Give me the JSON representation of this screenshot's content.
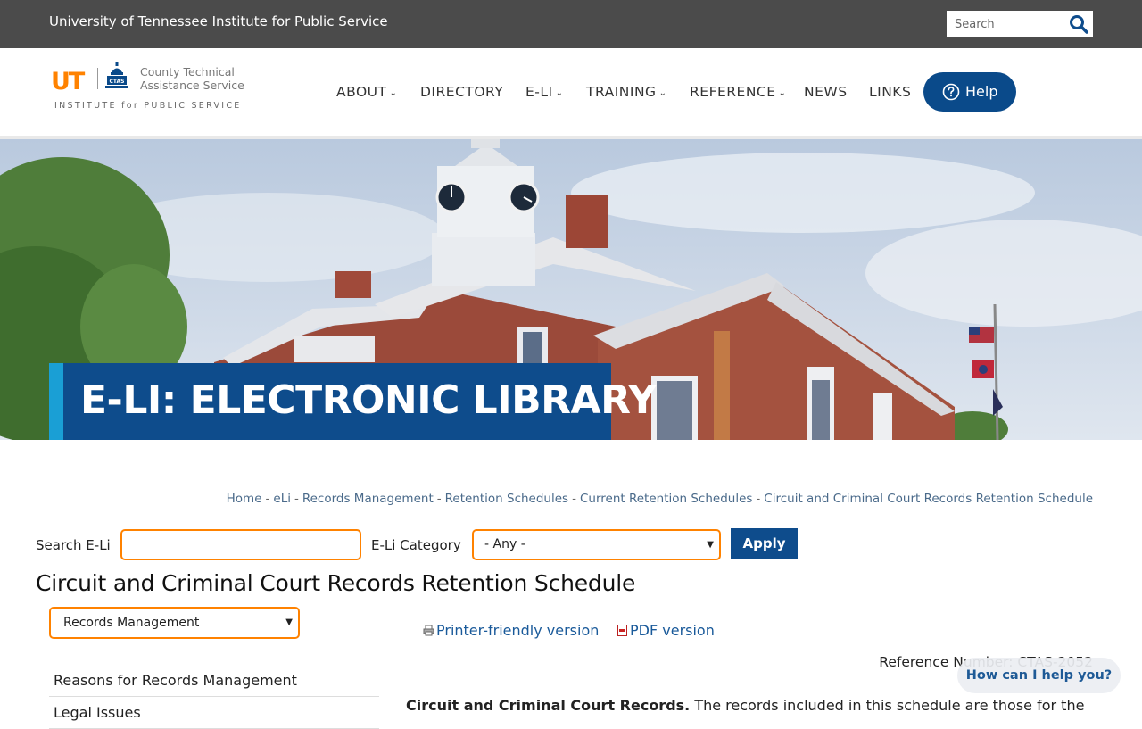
{
  "topbar": {
    "university": "University of Tennessee Institute for Public Service",
    "search_placeholder": "Search",
    "search_icon": "search-icon"
  },
  "logo": {
    "ut": "UT",
    "ctas_badge": "CTAS",
    "ctas_line1": "County Technical",
    "ctas_line2": "Assistance Service",
    "institute": "INSTITUTE for PUBLIC SERVICE"
  },
  "nav": {
    "items": [
      {
        "label": "ABOUT",
        "dropdown": true
      },
      {
        "label": "DIRECTORY",
        "dropdown": false
      },
      {
        "label": "E-LI",
        "dropdown": true
      },
      {
        "label": "TRAINING",
        "dropdown": true
      },
      {
        "label": "REFERENCE",
        "dropdown": true
      },
      {
        "label": "NEWS",
        "dropdown": false
      },
      {
        "label": "LINKS",
        "dropdown": false
      }
    ],
    "help_label": "Help",
    "help_icon": "question-circle-icon",
    "chevron": "⌄"
  },
  "hero": {
    "title": "E-LI: ELECTRONIC LIBRARY"
  },
  "breadcrumb": {
    "items": [
      "Home",
      "eLi",
      "Records Management",
      "Retention Schedules",
      "Current Retention Schedules",
      "Circuit and Criminal Court Records Retention Schedule"
    ],
    "separator": "-"
  },
  "search": {
    "label": "Search E-Li",
    "value": "",
    "category_label": "E-Li Category",
    "category_selected": "- Any -",
    "apply_label": "Apply"
  },
  "page": {
    "title": "Circuit and Criminal Court Records Retention Schedule",
    "section_select": "Records Management",
    "printer_link": "Printer-friendly version",
    "pdf_link": "PDF version",
    "reference": "Reference Number: CTAS-2052",
    "body_bold": "Circuit and Criminal Court Records.",
    "body_text": " The records included in this schedule are those for the"
  },
  "sidebar": {
    "items": [
      "Reasons for Records Management",
      "Legal Issues"
    ]
  },
  "chat": {
    "label": "How can I help you?"
  },
  "colors": {
    "topbar": "#4b4b4b",
    "brand_blue": "#0e4c8c",
    "accent_orange": "#ff8200",
    "accent_cyan": "#1a9fd5"
  }
}
